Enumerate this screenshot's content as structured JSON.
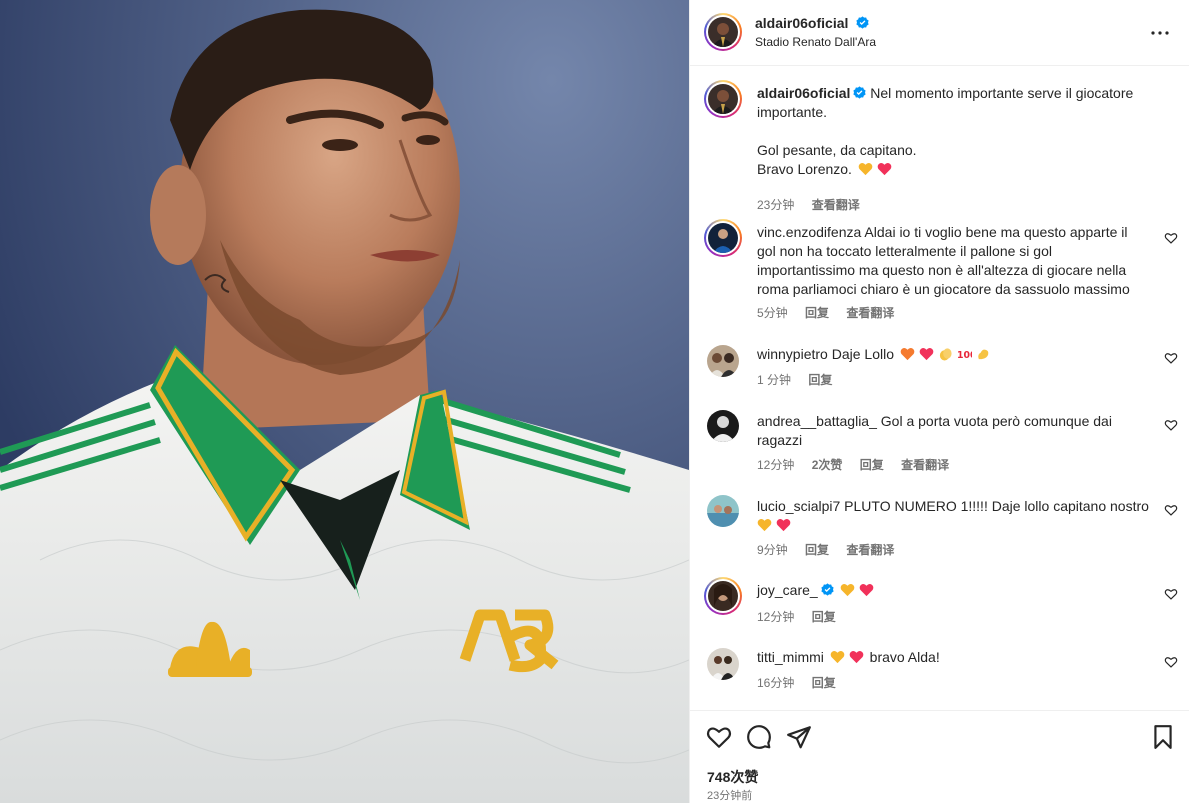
{
  "post": {
    "author": "aldair06oficial",
    "location": "Stadio Renato Dall'Ara",
    "caption_lines": [
      "Nel momento importante serve il giocatore",
      "importante.",
      "Gol pesante, da capitano.",
      "Bravo Lorenzo."
    ],
    "caption_time": "23分钟",
    "caption_translate": "查看翻译",
    "likes": "748次赞",
    "time_ago": "23分钟前"
  },
  "comments": [
    {
      "user": "vinc.enzodifenza",
      "lines": [
        "Aldai io ti voglio bene ma questo apparte il",
        "gol non ha toccato letteralmente il pallone si gol",
        "importantissimo ma questo non è all'altezza di giocare nella",
        "roma parliamoci chiaro è un giocatore da sassuolo massimo"
      ],
      "time": "5分钟",
      "reply": "回复",
      "translate": "查看翻译"
    },
    {
      "user": "winnypietro",
      "text": "Daje Lollo",
      "time": "1 分钟",
      "reply": "回复"
    },
    {
      "user": "andrea__battaglia_",
      "lines": [
        "Gol a porta vuota però comunque dai",
        "ragazzi"
      ],
      "time": "12分钟",
      "likes": "2次赞",
      "reply": "回复",
      "translate": "查看翻译"
    },
    {
      "user": "lucio_scialpi7",
      "text": "PLUTO NUMERO 1!!!!! Daje lollo capitano nostro",
      "time": "9分钟",
      "reply": "回复",
      "translate": "查看翻译"
    },
    {
      "user": "joy_care_",
      "time": "12分钟",
      "reply": "回复"
    },
    {
      "user": "titti_mimmi",
      "text": "bravo Alda!",
      "time": "16分钟",
      "reply": "回复"
    }
  ],
  "icons": {
    "like": "heart-icon",
    "comment": "comment-icon",
    "share": "share-icon",
    "save": "bookmark-icon",
    "more": "more-icon"
  },
  "colors": {
    "verified": "#0095f6",
    "heart_red": "#ff3040",
    "secondary_text": "#737373",
    "jersey_green": "#1f9a55",
    "jersey_gold": "#e8b027"
  }
}
